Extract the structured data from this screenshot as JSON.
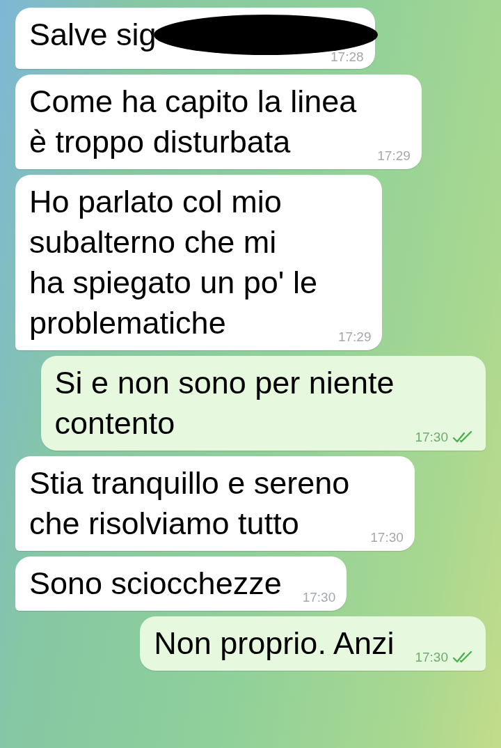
{
  "messages": [
    {
      "kind": "incoming",
      "text": "Salve sig",
      "redacted": true,
      "time": "17:28"
    },
    {
      "kind": "incoming",
      "text": "Come ha capito la linea\nè troppo disturbata",
      "time": "17:29"
    },
    {
      "kind": "incoming",
      "text": "Ho parlato col mio\nsubalterno che mi\nha spiegato un po' le\nproblematiche",
      "time": "17:29"
    },
    {
      "kind": "outgoing",
      "text": "Si e non sono per niente\ncontento",
      "time": "17:30",
      "read": true
    },
    {
      "kind": "incoming",
      "text": "Stia tranquillo e sereno\nche risolviamo tutto",
      "time": "17:30"
    },
    {
      "kind": "incoming",
      "text": "Sono sciocchezze",
      "time": "17:30"
    },
    {
      "kind": "outgoing",
      "text": "Non proprio. Anzi",
      "time": "17:30",
      "read": true
    }
  ]
}
